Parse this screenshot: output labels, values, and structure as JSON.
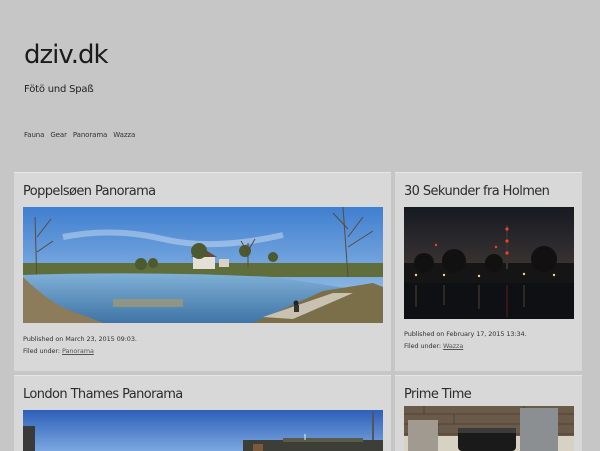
{
  "site": {
    "title": "dziv.dk",
    "tagline": "Fötö und Spaß"
  },
  "nav": [
    {
      "label": "Fauna"
    },
    {
      "label": "Gear"
    },
    {
      "label": "Panorama"
    },
    {
      "label": "Wazza"
    }
  ],
  "posts": [
    {
      "title": "Poppelsøen Panorama",
      "published_prefix": "Published on",
      "published_date": "March 23, 2015 09:03.",
      "filed_prefix": "Filed under:",
      "category": "Panorama"
    },
    {
      "title": "30 Sekunder fra Holmen",
      "published_prefix": "Published on",
      "published_date": "February 17, 2015 13:34.",
      "filed_prefix": "Filed under:",
      "category": "Wazza"
    },
    {
      "title": "London Thames Panorama"
    },
    {
      "title": "Prime Time"
    }
  ],
  "colors": {
    "page_background": "#c6c6c6",
    "card_background": "#d8d8d8",
    "sky": "#5d93d8",
    "water": "#5a8fbf",
    "night": "#1c1c22"
  }
}
